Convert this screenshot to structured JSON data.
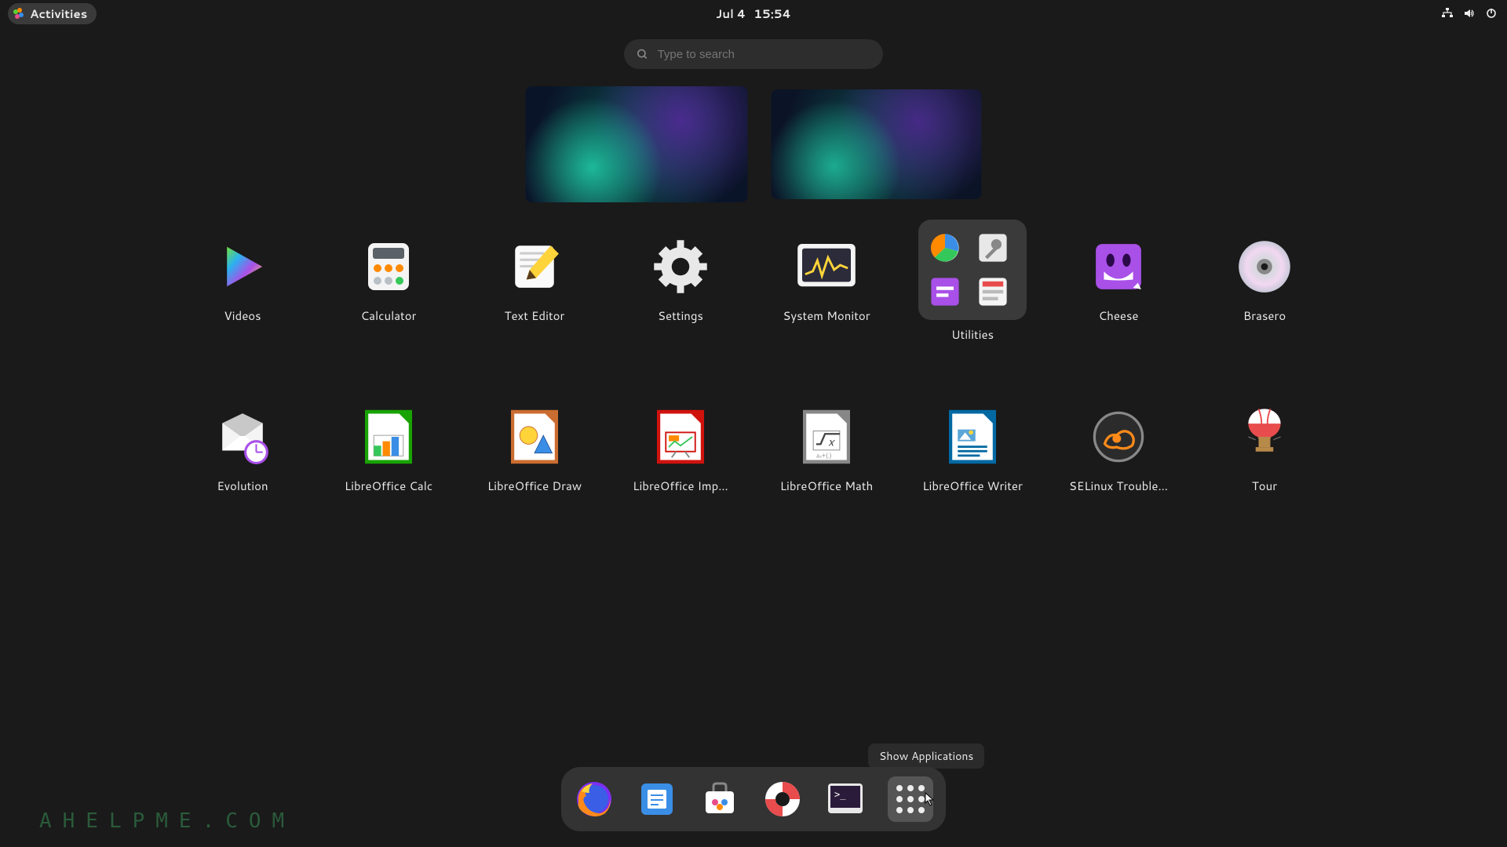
{
  "topbar": {
    "activities": "Activities",
    "date": "Jul 4",
    "time": "15:54",
    "status_icons": [
      "network-wired",
      "volume",
      "power"
    ]
  },
  "search": {
    "placeholder": "Type to search"
  },
  "workspaces": [
    {
      "id": 1,
      "active": true
    },
    {
      "id": 2,
      "active": false
    }
  ],
  "apps_row1": [
    {
      "name": "Videos",
      "icon": "videos"
    },
    {
      "name": "Calculator",
      "icon": "calculator"
    },
    {
      "name": "Text Editor",
      "icon": "text-editor"
    },
    {
      "name": "Settings",
      "icon": "settings"
    },
    {
      "name": "System Monitor",
      "icon": "system-monitor"
    },
    {
      "name": "Utilities",
      "icon": "folder",
      "folder": true
    },
    {
      "name": "Cheese",
      "icon": "cheese"
    },
    {
      "name": "Brasero",
      "icon": "brasero"
    }
  ],
  "apps_row2": [
    {
      "name": "Evolution",
      "icon": "evolution"
    },
    {
      "name": "LibreOffice Calc",
      "icon": "lo-calc"
    },
    {
      "name": "LibreOffice Draw",
      "icon": "lo-draw"
    },
    {
      "name": "LibreOffice Imp…",
      "icon": "lo-impress"
    },
    {
      "name": "LibreOffice Math",
      "icon": "lo-math"
    },
    {
      "name": "LibreOffice Writer",
      "icon": "lo-writer"
    },
    {
      "name": "SELinux Trouble…",
      "icon": "selinux"
    },
    {
      "name": "Tour",
      "icon": "tour"
    }
  ],
  "dock": [
    {
      "name": "Firefox",
      "icon": "firefox"
    },
    {
      "name": "Files",
      "icon": "files"
    },
    {
      "name": "Software",
      "icon": "software"
    },
    {
      "name": "Help",
      "icon": "help"
    },
    {
      "name": "Terminal",
      "icon": "terminal"
    },
    {
      "name": "Show Applications",
      "icon": "apps-grid",
      "active": true
    }
  ],
  "tooltip": "Show Applications",
  "watermark": "AHELPME.COM"
}
